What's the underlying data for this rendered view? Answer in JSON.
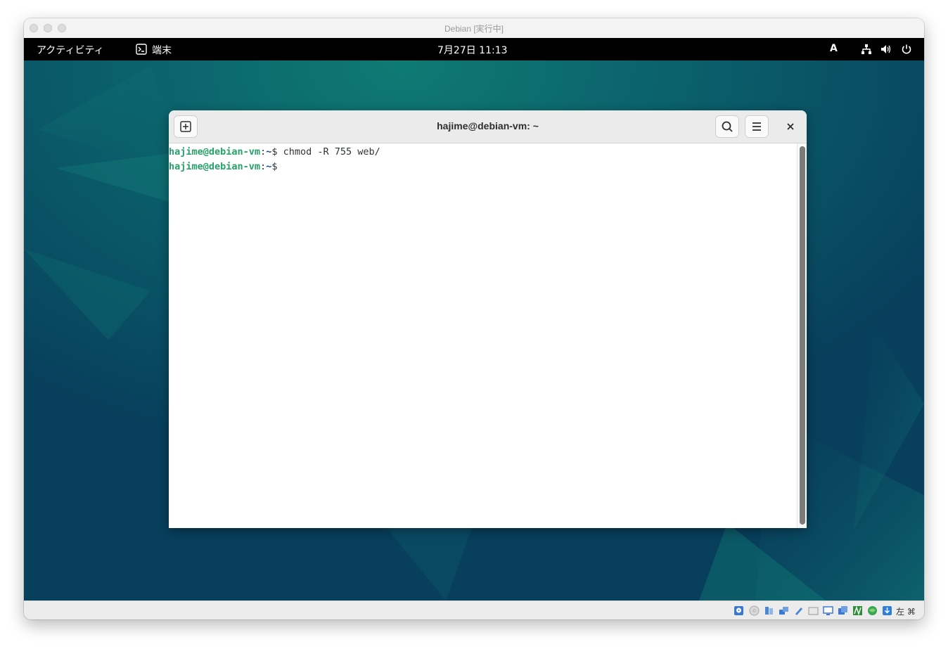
{
  "host_window": {
    "title": "Debian [実行中]",
    "traffic_lights": [
      "close-button",
      "minimize-button",
      "zoom-button"
    ]
  },
  "topbar": {
    "activities_label": "アクティビティ",
    "app_icon": "terminal-icon",
    "app_label": "端末",
    "clock": "7月27日  11:13",
    "input_method": "A",
    "status_icons": [
      "network-icon",
      "volume-icon",
      "power-icon"
    ]
  },
  "terminal": {
    "title": "hajime@debian-vm: ~",
    "new_tab_icon": "new-tab-icon",
    "search_icon": "search-icon",
    "menu_icon": "hamburger-menu-icon",
    "close_icon": "close-icon",
    "lines": [
      {
        "user_host": "hajime@debian-vm",
        "sep": ":",
        "path": "~",
        "prompt": "$",
        "command": " chmod -R 755 web/"
      },
      {
        "user_host": "hajime@debian-vm",
        "sep": ":",
        "path": "~",
        "prompt": "$",
        "command": ""
      }
    ],
    "colors": {
      "user_host": "#26a269",
      "path": "#12488b"
    }
  },
  "statusbar": {
    "icons": [
      "hard-disk-icon",
      "optical-drive-icon",
      "audio-icon",
      "network-adapter-icon",
      "usb-icon",
      "shared-folder-icon",
      "display-icon",
      "screen-capture-icon",
      "recording-icon",
      "cpu-icon",
      "mouse-integration-icon",
      "download-icon"
    ],
    "host_key": "左 ⌘"
  },
  "colors": {
    "desktop_bg": "#0a4f63",
    "topbar_bg": "#000000",
    "accent_teal": "#11806f"
  }
}
